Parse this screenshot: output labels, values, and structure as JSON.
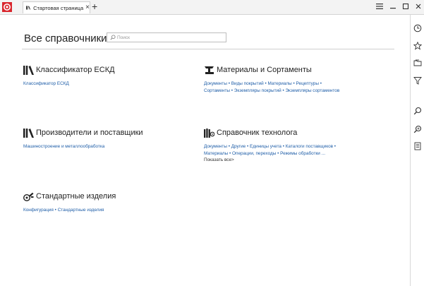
{
  "tab": {
    "title": "Стартовая страница",
    "close": "×",
    "new_tab": "+"
  },
  "header": {
    "title": "Все справочники"
  },
  "search": {
    "placeholder": "Поиск"
  },
  "sections": [
    {
      "title": "Классификатор ЕСКД",
      "icon": "books-icon",
      "links": [
        "Классификатор ЕСКД"
      ]
    },
    {
      "title": "Материалы и Сортаменты",
      "icon": "materials-icon",
      "links": [
        "Документы",
        "Виды покрытий",
        "Материалы",
        "Рецептуры",
        "Сортаменты",
        "Экземпляры покрытий",
        "Экземпляры сортаментов"
      ]
    },
    {
      "title": "Производители и поставщики",
      "icon": "books-icon",
      "links": [
        "Машиностроение и металлообработка"
      ]
    },
    {
      "title": "Справочник технолога",
      "icon": "technologist-icon",
      "links": [
        "Документы",
        "Другие",
        "Единицы учета",
        "Каталоги поставщиков",
        "Материалы",
        "Операции, переходы",
        "Режимы обработки ..."
      ],
      "show_all": "Показать все>"
    },
    {
      "title": "Стандартные изделия",
      "icon": "standard-parts-icon",
      "links": [
        "Конфигурация",
        "Стандартные изделия"
      ]
    }
  ],
  "colors": {
    "link": "#1f5ea8",
    "app_icon": "#d9272e"
  }
}
